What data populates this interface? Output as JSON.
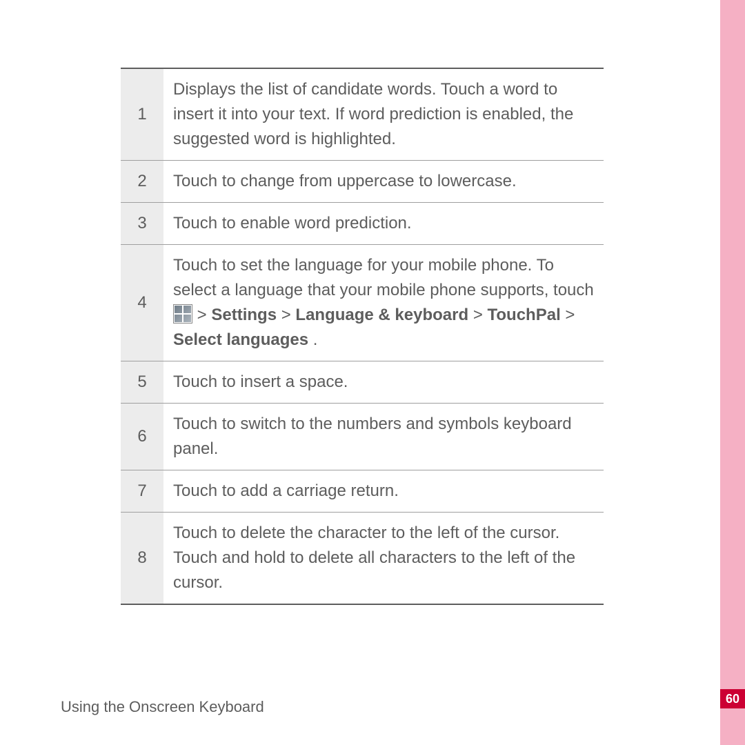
{
  "page_number": "60",
  "footer": "Using the Onscreen Keyboard",
  "rows": [
    {
      "num": "1",
      "desc": "Displays the list of candidate words. Touch a word to insert it into your text. If word prediction is enabled, the suggested word is highlighted."
    },
    {
      "num": "2",
      "desc": "Touch to change from uppercase to lowercase."
    },
    {
      "num": "3",
      "desc": "Touch to enable word prediction."
    },
    {
      "num": "4",
      "desc_pre": "Touch to set the language for your mobile phone. To select a language that your mobile phone supports, touch ",
      "desc_mid": " > ",
      "bold1": "Settings",
      "sep1": " > ",
      "bold2": "Language & keyboard",
      "sep2": " > ",
      "bold3": "TouchPal",
      "sep3": " > ",
      "bold4": "Select languages",
      "desc_post": "."
    },
    {
      "num": "5",
      "desc": "Touch to insert a space."
    },
    {
      "num": "6",
      "desc": "Touch to switch to the numbers and symbols keyboard panel."
    },
    {
      "num": "7",
      "desc": "Touch to add a carriage return."
    },
    {
      "num": "8",
      "desc": "Touch to delete the character to the left of the cursor. Touch and hold to delete all characters to the left of the cursor."
    }
  ]
}
